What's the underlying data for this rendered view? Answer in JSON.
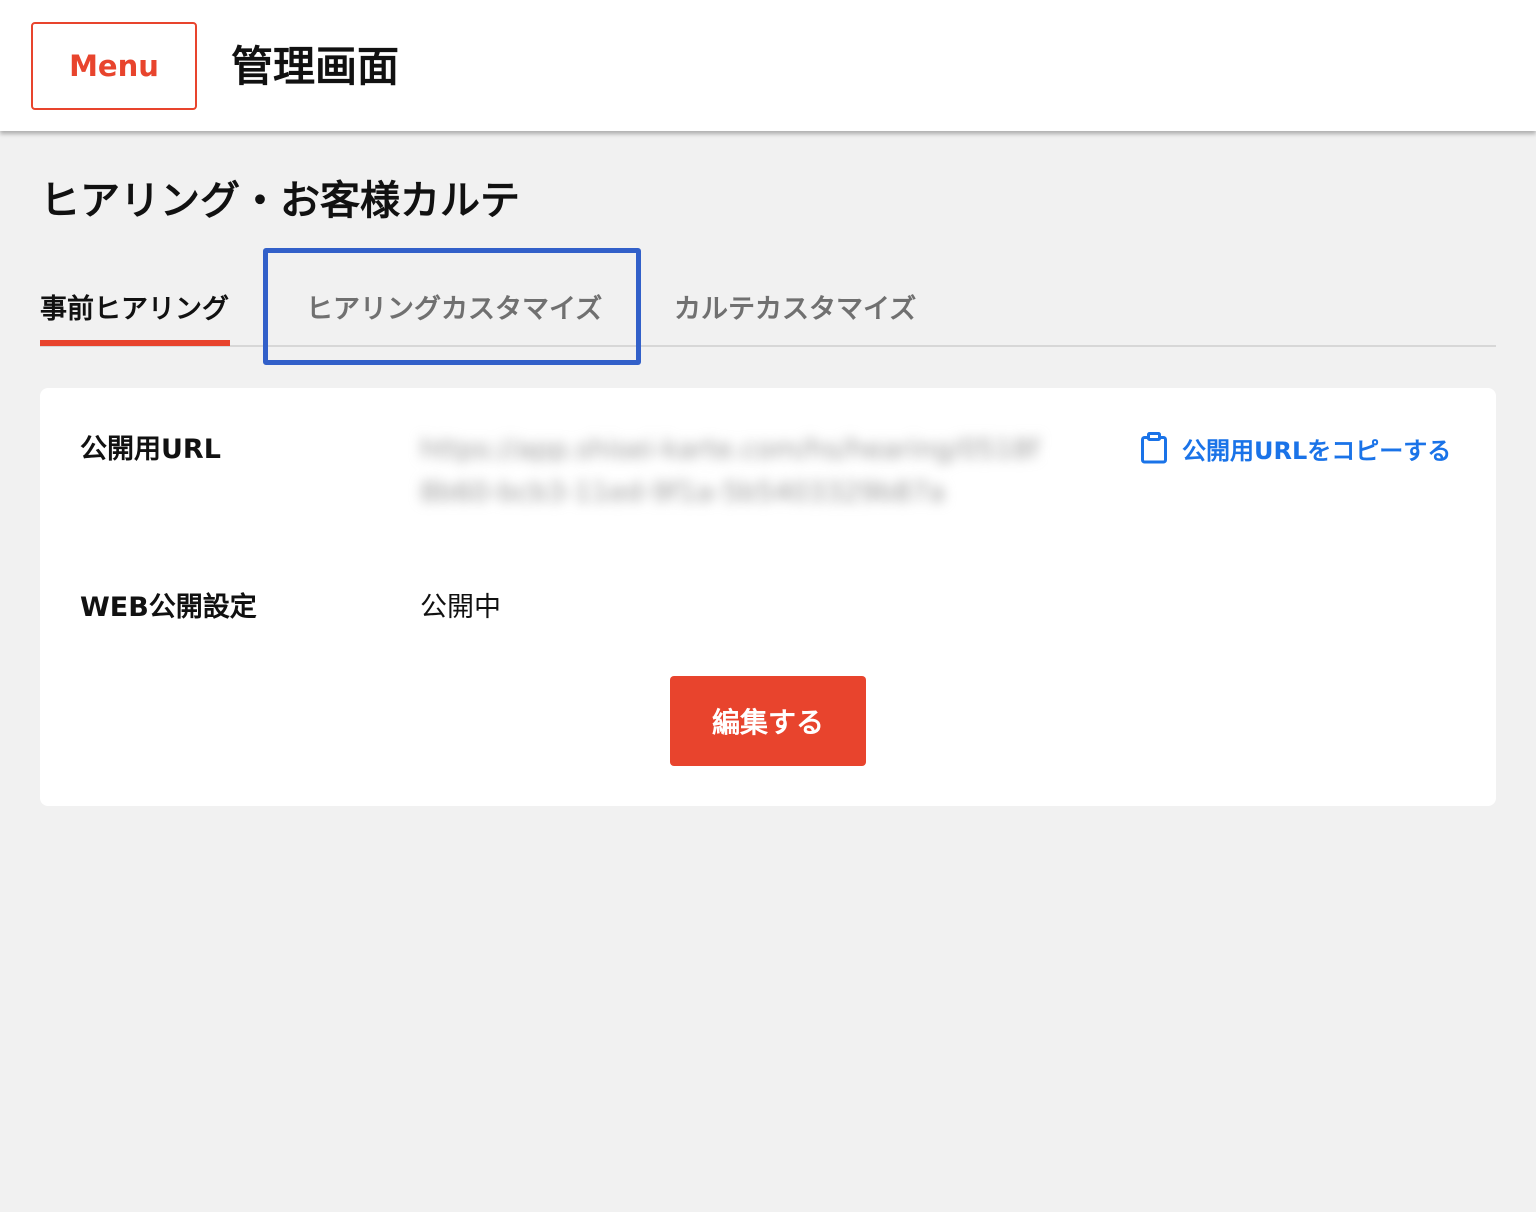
{
  "header": {
    "menu_label": "Menu",
    "app_title": "管理画面"
  },
  "page": {
    "title": "ヒアリング・お客様カルテ"
  },
  "tabs": [
    {
      "label": "事前ヒアリング",
      "active": true
    },
    {
      "label": "ヒアリングカスタマイズ",
      "active": false
    },
    {
      "label": "カルテカスタマイズ",
      "active": false
    }
  ],
  "card": {
    "url_label": "公開用URL",
    "url_value": "https://app.shisei-karte.com/hs/hearing/0518f8b60-bcb3-11ed-9f1a-5b5403329b87a",
    "copy_label": "公開用URLをコピーする",
    "web_label": "WEB公開設定",
    "web_status": "公開中",
    "edit_label": "編集する"
  },
  "colors": {
    "accent": "#e8442d",
    "link": "#1a73e8",
    "highlight": "#3260c9",
    "background": "#f1f1f1"
  },
  "icons": {
    "copy": "clipboard-icon"
  }
}
